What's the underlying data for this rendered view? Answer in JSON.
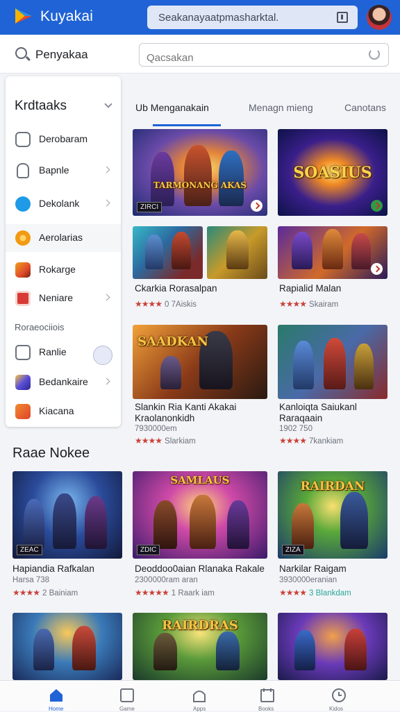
{
  "app": {
    "title": "Kuyakai",
    "search_value": "Seakanayaatpmasharktal."
  },
  "searchbar": {
    "label": "Penyakaa",
    "placeholder": "Qacsakan"
  },
  "sidebar": {
    "title": "Krdtaaks",
    "items": [
      {
        "label": "Derobaram",
        "icon": "monitor-icon",
        "color": "#6c717c",
        "arrow": false
      },
      {
        "label": "Bapnle",
        "icon": "phone-icon",
        "color": "#6c717c",
        "arrow": true
      },
      {
        "label": "Dekolank",
        "icon": "compass-icon",
        "color": "#1e9ae6",
        "arrow": true
      },
      {
        "label": "Aerolarias",
        "icon": "coin-icon",
        "color": "#f29a12",
        "arrow": false
      },
      {
        "label": "Rokarge",
        "icon": "game-icon",
        "color": "#e04b2a",
        "arrow": false
      },
      {
        "label": "Neniare",
        "icon": "badge-icon",
        "color": "#d83a36",
        "arrow": true
      }
    ],
    "section_label": "Roraeociiois",
    "sub_items": [
      {
        "label": "Ranlie",
        "icon": "puzzle-icon",
        "color": "#6c717c"
      },
      {
        "label": "Bedankaire",
        "icon": "palette-icon",
        "color": "#5b4fd8",
        "arrow": true
      },
      {
        "label": "Kiacana",
        "icon": "flame-icon",
        "color": "#e0432b"
      }
    ]
  },
  "tabs": [
    {
      "label": "Ub Menganakain",
      "selected": true
    },
    {
      "label": "Menagn mieng",
      "selected": false
    },
    {
      "label": "Canotans",
      "selected": false
    }
  ],
  "featured": [
    {
      "banner": "TARMONANG AKAS",
      "tag": "ZIRCI"
    },
    {
      "banner": "SOASIUS",
      "tag": ""
    }
  ],
  "row2": [
    {
      "title": "Ckarkia Rorasalpan",
      "meta": "0 7Aiskis",
      "stars": "★★★★"
    },
    {
      "title": "Rapialid Malan",
      "meta": "Skairam",
      "stars": "★★★★"
    }
  ],
  "row3": [
    {
      "banner": "SAADKAN",
      "title": "Slankin Ria Kanti Akakai Kraolanonkidh",
      "sub": "7930000em",
      "meta": "Slarkiam",
      "stars": "★★★★"
    },
    {
      "banner": "",
      "title": "Kanloiqta Saiukanl Raraqaain",
      "sub": "1902 750",
      "meta": "7kankiam",
      "stars": "★★★★"
    }
  ],
  "section": {
    "title": "Raae Nokee"
  },
  "row4": [
    {
      "banner": "",
      "title": "Hapiandia Rafkalan",
      "sub": "Harsa 738",
      "meta": "2 Bainiam",
      "stars": "★★★★",
      "tag": "ZEAC"
    },
    {
      "banner": "SAMLAUS",
      "title": "Deoddoo0aian Rlanaka Rakale",
      "sub": "2300000ram aran",
      "meta": "1 Raark iam",
      "stars": "★★★★★",
      "tag": "ZDIC"
    },
    {
      "banner": "RAIRDAN",
      "title": "Narkilar Raigam",
      "sub": "3930000eranian",
      "meta": "3 Blankdam",
      "stars": "★★★★",
      "tag": "ZIZA"
    }
  ],
  "row5": [
    {
      "banner": ""
    },
    {
      "banner": "RAIRDRAS"
    },
    {
      "banner": ""
    }
  ],
  "bottom_nav": [
    {
      "icon": "home-icon",
      "label": "Home"
    },
    {
      "icon": "tablet-icon",
      "label": "Game"
    },
    {
      "icon": "bag-icon",
      "label": "Apps"
    },
    {
      "icon": "calendar-icon",
      "label": "Books"
    },
    {
      "icon": "clock-icon",
      "label": "Kidos"
    }
  ]
}
